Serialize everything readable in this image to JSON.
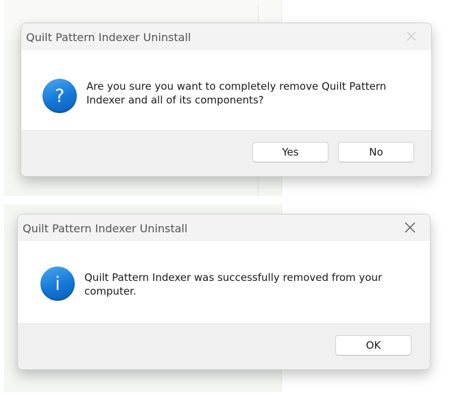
{
  "dialog_confirm": {
    "title": "Quilt Pattern Indexer Uninstall",
    "icon": "question-icon",
    "icon_glyph": "?",
    "message": "Are you sure you want to completely remove Quilt Pattern Indexer and all of its components?",
    "buttons": {
      "yes_label": "Yes",
      "no_label": "No"
    },
    "close_enabled": false
  },
  "dialog_done": {
    "title": "Quilt Pattern Indexer Uninstall",
    "icon": "info-icon",
    "icon_glyph": "i",
    "message": "Quilt Pattern Indexer was successfully removed from your computer.",
    "buttons": {
      "ok_label": "OK"
    },
    "close_enabled": true
  },
  "colors": {
    "icon_blue": "#1478d8",
    "titlebar": "#f3f3f3",
    "button_bar": "#f0f0f0",
    "close_disabled": "#c8c8c8",
    "close_enabled": "#555555"
  }
}
